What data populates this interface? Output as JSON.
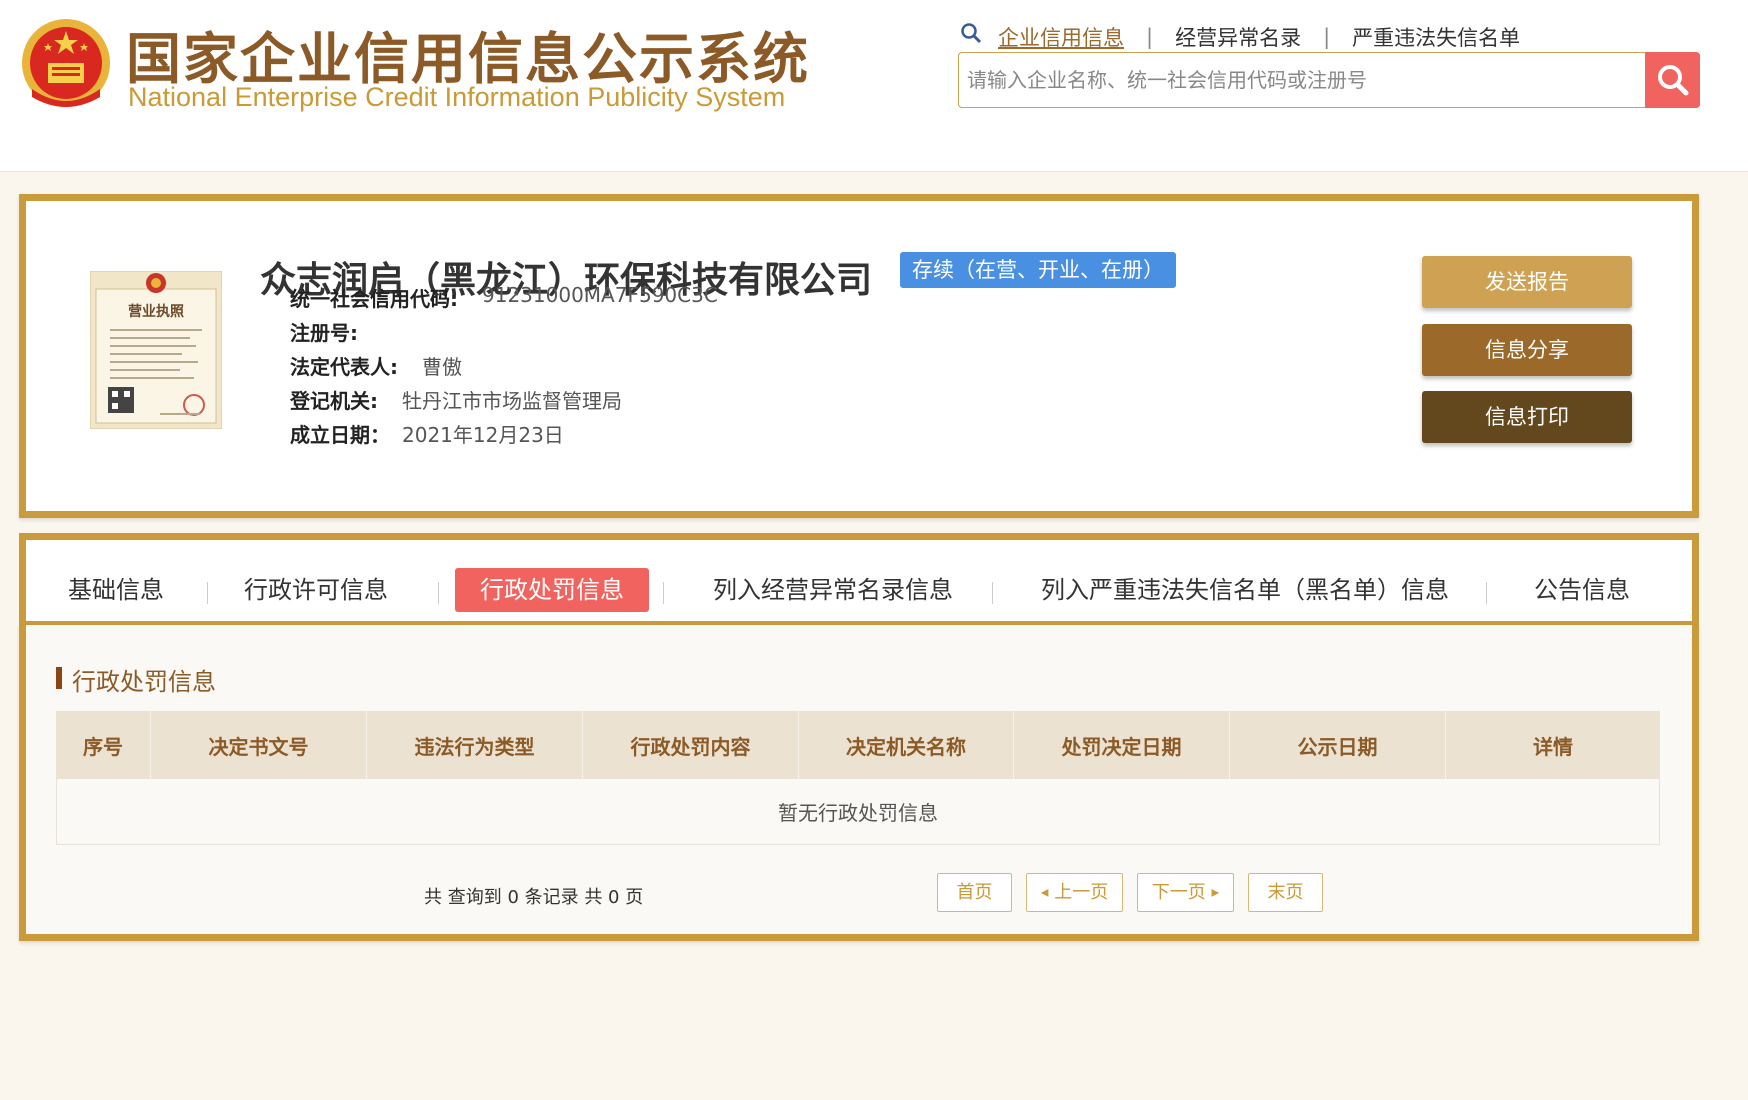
{
  "header": {
    "title": "国家企业信用信息公示系统",
    "subtitle": "National Enterprise Credit Information Publicity System",
    "links": [
      "企业信用信息",
      "经营异常名录",
      "严重违法失信名单"
    ],
    "search_placeholder": "请输入企业名称、统一社会信用代码或注册号"
  },
  "company": {
    "name": "众志润启（黑龙江）环保科技有限公司",
    "status": "存续（在营、开业、在册）",
    "fields": [
      {
        "label": "统一社会信用代码:",
        "value": "91231000MA7F590C3C"
      },
      {
        "label": "注册号:",
        "value": ""
      },
      {
        "label": "法定代表人:",
        "value": "曹傲"
      },
      {
        "label": "登记机关:",
        "value": "牡丹江市市场监督管理局"
      },
      {
        "label": "成立日期：",
        "value": "2021年12月23日"
      }
    ],
    "license_heading": "营业执照"
  },
  "actions": {
    "send": "发送报告",
    "share": "信息分享",
    "print": "信息打印"
  },
  "tabs": [
    "基础信息",
    "行政许可信息",
    "行政处罚信息",
    "列入经营异常名录信息",
    "列入严重违法失信名单（黑名单）信息",
    "公告信息"
  ],
  "active_tab": "行政处罚信息",
  "section": {
    "title": "行政处罚信息",
    "columns": [
      "序号",
      "决定书文号",
      "违法行为类型",
      "行政处罚内容",
      "决定机关名称",
      "处罚决定日期",
      "公示日期",
      "详情"
    ],
    "empty_text": "暂无行政处罚信息",
    "record_summary": "共 查询到 0 条记录 共 0 页"
  },
  "pagination": {
    "first": "首页",
    "prev": "上一页",
    "next": "下一页",
    "last": "末页"
  },
  "colors": {
    "gold_border": "#c99b3b",
    "brown_title": "#8b5a26",
    "active_tab": "#f1635e",
    "status_badge": "#4a90e2"
  }
}
